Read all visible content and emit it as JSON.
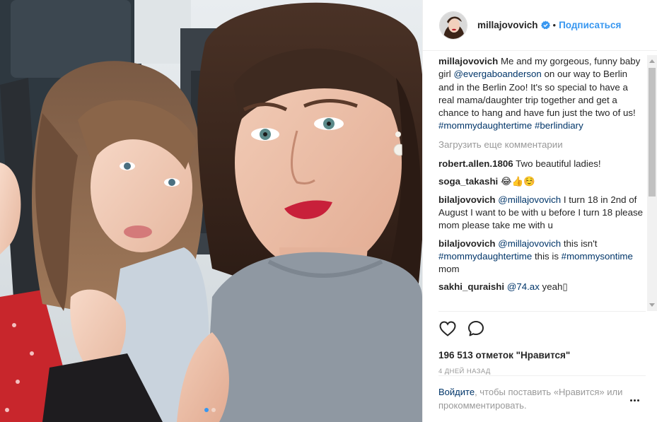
{
  "post": {
    "username": "millajovovich",
    "follow_label": "Подписаться",
    "separator": "•"
  },
  "caption": {
    "username": "millajovovich",
    "text_1": " Me and my gorgeous, funny baby girl ",
    "mention": "@evergaboanderson",
    "text_2": " on our way to Berlin and in the Berlin Zoo! It's so special to have a real mama/daughter trip together and get a chance to hang and have fun just the two of us! ",
    "hashtag_1": "#mommydaughtertime",
    "hashtag_2": "#berlindiary"
  },
  "load_more": "Загрузить еще комментарии",
  "comments": [
    {
      "username": "robert.allen.1806",
      "text": " Two beautiful ladies!"
    },
    {
      "username": "soga_takashi",
      "text": " 😂👍☺️"
    },
    {
      "username": "bilaljovovich",
      "mention": "@millajovovich",
      "text": " I turn 18 in 2nd of August I want to be with u before I turn 18 please mom please take me with u"
    },
    {
      "username": "bilaljovovich",
      "mention": "@millajovovich",
      "text_1": " this isn't ",
      "hashtag_1": "#mommydaughtertime",
      "text_2": " this is ",
      "hashtag_2": "#mommysontime",
      "text_3": " mom"
    },
    {
      "username": "sakhi_quraishi",
      "mention": "@74.ax",
      "text": " yeah▯"
    }
  ],
  "likes": "196 513 отметок \"Нравится\"",
  "time": "4 дней назад",
  "login": {
    "link": "Войдите",
    "text": ", чтобы поставить «Нравится» или прокомментировать."
  },
  "colors": {
    "accent": "#3897f0",
    "link": "#003569",
    "muted": "#999999",
    "text": "#262626"
  },
  "icons": {
    "like": "heart-icon",
    "comment": "comment-bubble-icon",
    "verified": "verified-badge-icon",
    "more": "more-options-icon"
  },
  "carousel": {
    "count": 2,
    "active": 1
  }
}
